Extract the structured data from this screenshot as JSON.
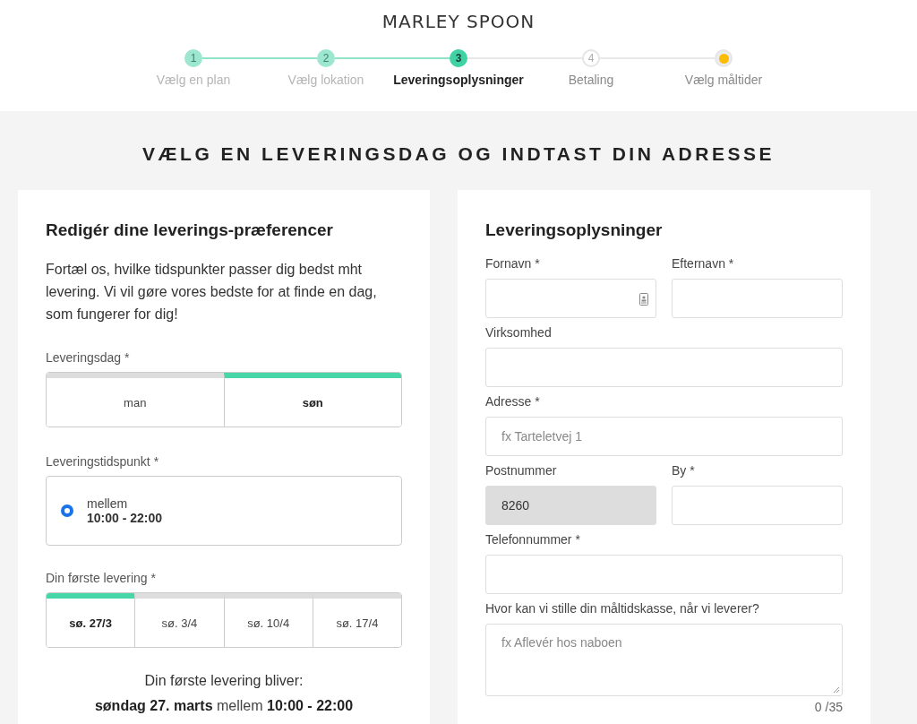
{
  "logo": "MARLEY SPOON",
  "steps": [
    {
      "kind": "number",
      "number": "1",
      "label": "Vælg en plan",
      "done": true,
      "current": false
    },
    {
      "kind": "number",
      "number": "2",
      "label": "Vælg lokation",
      "done": true,
      "current": false
    },
    {
      "kind": "number",
      "number": "3",
      "label": "Leveringsoplysninger",
      "done": false,
      "current": true
    },
    {
      "kind": "number",
      "number": "4",
      "label": "Betaling",
      "done": false,
      "current": false
    },
    {
      "kind": "dot",
      "label": "Vælg måltider",
      "done": false,
      "current": false
    }
  ],
  "page_title": "VÆLG EN LEVERINGSDAG OG INDTAST DIN ADRESSE",
  "preferences": {
    "title": "Redigér dine leverings-præferencer",
    "intro": "Fortæl os, hvilke tidspunkter passer dig bedst mht levering. Vi vil gøre vores bedste for at finde en dag, som fungerer for dig!",
    "day_label": "Leveringsdag *",
    "days": [
      {
        "label": "man",
        "selected": false
      },
      {
        "label": "søn",
        "selected": true
      }
    ],
    "time_label": "Leveringstidspunkt *",
    "time_option": {
      "prefix": "mellem",
      "time": "10:00 - 22:00",
      "selected": true
    },
    "first_label": "Din første levering *",
    "dates": [
      {
        "label": "sø. 27/3",
        "selected": true
      },
      {
        "label": "sø. 3/4",
        "selected": false
      },
      {
        "label": "sø. 10/4",
        "selected": false
      },
      {
        "label": "sø. 17/4",
        "selected": false
      }
    ],
    "summary_title": "Din første levering bliver:",
    "summary": "**søndag 27. marts** mellem **10:00 - 22:00**"
  },
  "delivery": {
    "title": "Leveringsoplysninger",
    "rows": [
      [
        {
          "label": "Fornavn *",
          "kind": "text",
          "contact_icon": true
        },
        {
          "label": "Efternavn *",
          "kind": "text"
        }
      ],
      [
        {
          "label": "Virksomhed",
          "kind": "text"
        }
      ],
      [
        {
          "label": "Adresse *",
          "kind": "text",
          "placeholder": "fx Tarteletvej 1"
        }
      ],
      [
        {
          "label": "Postnummer",
          "kind": "text",
          "value": "8260",
          "disabled": true
        },
        {
          "label": "By *",
          "kind": "text"
        }
      ],
      [
        {
          "label": "Telefonnummer *",
          "kind": "text"
        }
      ],
      [
        {
          "label": "Hvor kan vi stille din måltidskasse, når vi leverer?",
          "kind": "textarea",
          "placeholder": "fx Aflevér hos naboen",
          "counter": "0 /35"
        }
      ]
    ]
  }
}
